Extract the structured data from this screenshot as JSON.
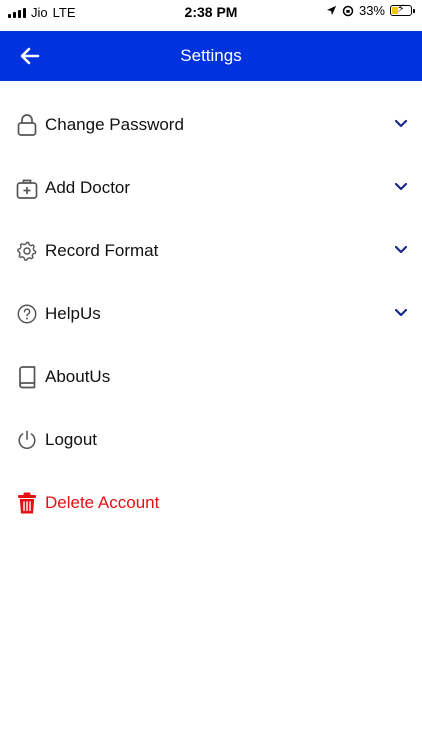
{
  "status_bar": {
    "carrier": "Jio",
    "network": "LTE",
    "time": "2:38 PM",
    "battery": "33%",
    "battery_level": 0.33
  },
  "header": {
    "title": "Settings",
    "back_icon": "arrow-left-icon",
    "background_color": "#0033dd"
  },
  "menu": {
    "items": [
      {
        "label": "Change Password",
        "icon": "lock-icon",
        "expandable": true
      },
      {
        "label": "Add Doctor",
        "icon": "medical-bag-icon",
        "expandable": true
      },
      {
        "label": "Record Format",
        "icon": "gear-icon",
        "expandable": true
      },
      {
        "label": "HelpUs",
        "icon": "help-circle-icon",
        "expandable": true
      },
      {
        "label": "AboutUs",
        "icon": "book-icon",
        "expandable": false
      },
      {
        "label": "Logout",
        "icon": "power-icon",
        "expandable": false
      },
      {
        "label": "Delete Account",
        "icon": "trash-icon",
        "expandable": false,
        "color": "#e31212"
      }
    ],
    "chevron_color": "#1a2a8a"
  }
}
